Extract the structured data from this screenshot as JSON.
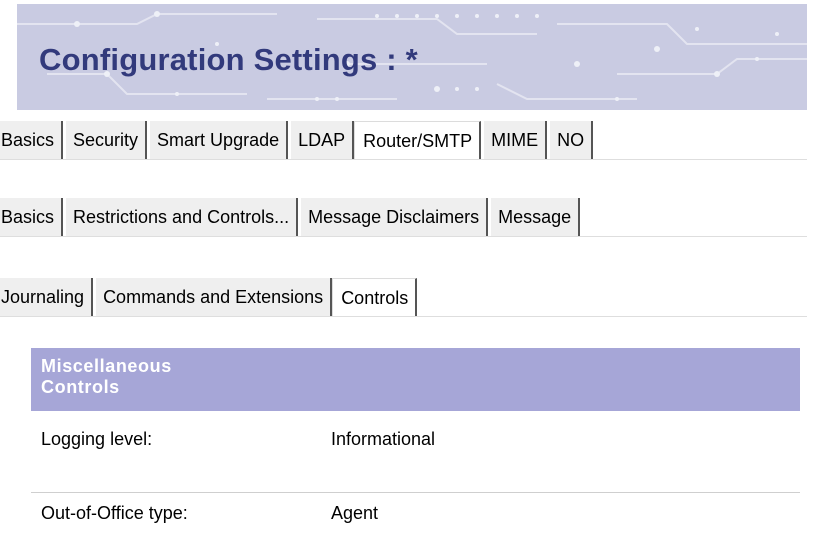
{
  "header": {
    "title": "Configuration Settings : *"
  },
  "tabs_level1": {
    "items": [
      {
        "label": "Basics",
        "active": false
      },
      {
        "label": "Security",
        "active": false
      },
      {
        "label": "Smart Upgrade",
        "active": false
      },
      {
        "label": "LDAP",
        "active": false
      },
      {
        "label": "Router/SMTP",
        "active": true
      },
      {
        "label": "MIME",
        "active": false
      },
      {
        "label": "NO",
        "active": false
      }
    ]
  },
  "tabs_level2": {
    "items": [
      {
        "label": "Basics",
        "active": false
      },
      {
        "label": "Restrictions and Controls...",
        "active": false
      },
      {
        "label": "Message Disclaimers",
        "active": false
      },
      {
        "label": "Message",
        "active": false
      }
    ]
  },
  "tabs_level3": {
    "items": [
      {
        "label": "Journaling",
        "active": false
      },
      {
        "label": "Commands and Extensions",
        "active": false
      },
      {
        "label": "Controls",
        "active": true
      }
    ]
  },
  "section": {
    "title_line1": "Miscellaneous",
    "title_line2": "Controls",
    "rows": [
      {
        "label": "Logging level:",
        "value": "Informational"
      },
      {
        "label": "Out-of-Office type:",
        "value": "Agent"
      }
    ]
  },
  "colors": {
    "banner": "#c9cbe2",
    "title": "#323a7c",
    "section_header": "#a6a6d7"
  }
}
